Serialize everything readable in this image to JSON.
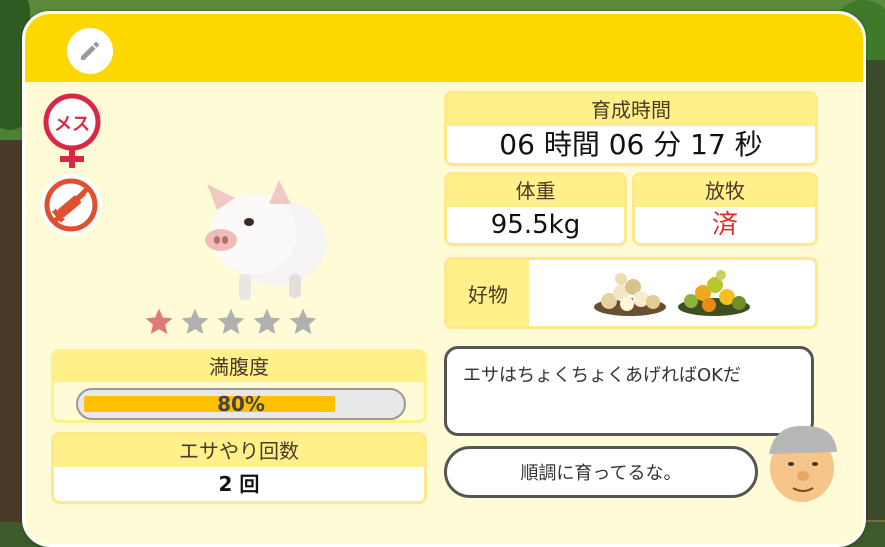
{
  "profile": {
    "gender_label": "メス",
    "stars": {
      "rating": 1,
      "max": 5
    }
  },
  "stats": {
    "rearing_time": {
      "label": "育成時間",
      "value": "06 時間 06 分 17 秒"
    },
    "weight": {
      "label": "体重",
      "value": "95.5kg"
    },
    "grazing": {
      "label": "放牧",
      "value": "済"
    },
    "favorite": {
      "label": "好物"
    },
    "fullness": {
      "label": "満腹度",
      "value_text": "80%",
      "percent": 80
    },
    "feed_count": {
      "label": "エサやり回数",
      "value": "2 回"
    }
  },
  "dialog": {
    "tip": "エサはちょくちょくあげればOKだ",
    "comment": "順調に育ってるな。"
  },
  "colors": {
    "header_yellow": "#ffd800",
    "panel_bg": "#fffbd6",
    "label_bg": "#fff08a",
    "gauge_fill": "#ffc000",
    "red_accent": "#e02b2b",
    "star_active": "#e07a7a",
    "star_inactive": "#b0b0b0"
  },
  "icons": [
    "pencil-icon",
    "female-icon",
    "no-injection-icon",
    "star-icon",
    "beige-food-pile-icon",
    "green-food-pile-icon",
    "farmer-avatar-icon"
  ]
}
